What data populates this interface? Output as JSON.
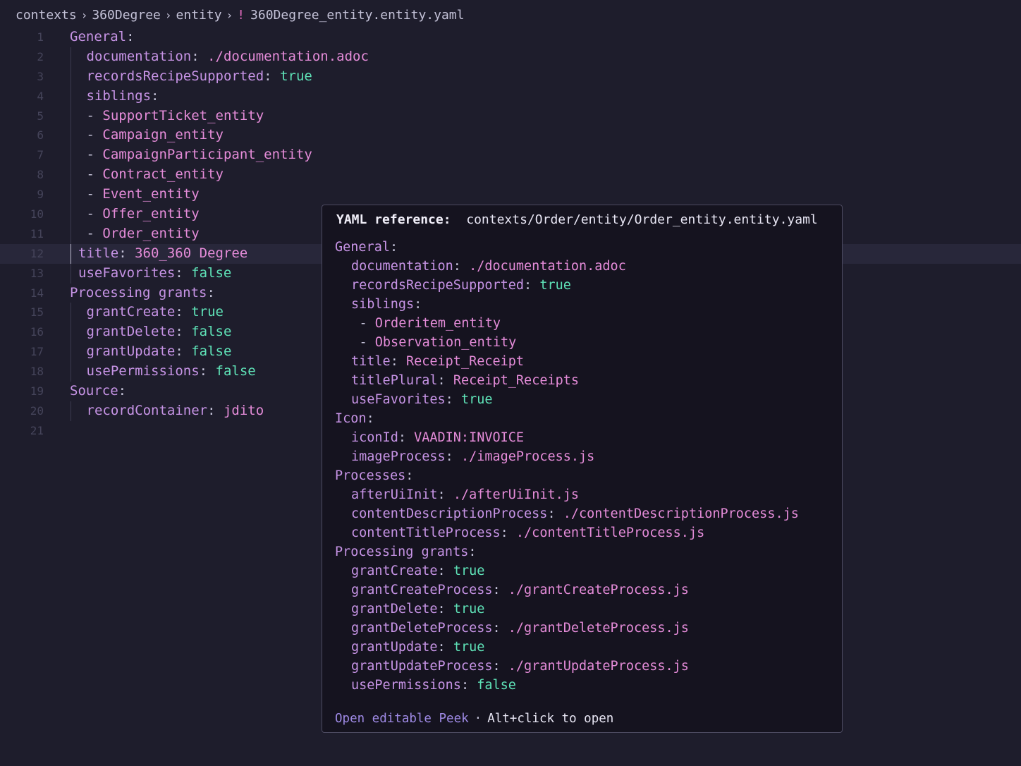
{
  "breadcrumb": {
    "items": [
      "contexts",
      "360Degree",
      "entity"
    ],
    "file_marker": "!",
    "file_name": "360Degree_entity.entity.yaml"
  },
  "editor": {
    "active_line": 12,
    "lines": [
      {
        "n": "1",
        "indent": 0,
        "guide": false,
        "parts": [
          {
            "t": "General",
            "c": "k"
          },
          {
            "t": ":",
            "c": "p"
          }
        ]
      },
      {
        "n": "2",
        "indent": 1,
        "guide": true,
        "parts": [
          {
            "t": "documentation",
            "c": "k"
          },
          {
            "t": ": ",
            "c": "p"
          },
          {
            "t": "./documentation.adoc",
            "c": "s"
          }
        ]
      },
      {
        "n": "3",
        "indent": 1,
        "guide": true,
        "parts": [
          {
            "t": "recordsRecipeSupported",
            "c": "k"
          },
          {
            "t": ": ",
            "c": "p"
          },
          {
            "t": "true",
            "c": "b"
          }
        ]
      },
      {
        "n": "4",
        "indent": 1,
        "guide": true,
        "parts": [
          {
            "t": "siblings",
            "c": "k"
          },
          {
            "t": ":",
            "c": "p"
          }
        ]
      },
      {
        "n": "5",
        "indent": 1,
        "guide": true,
        "parts": [
          {
            "t": "- ",
            "c": "p"
          },
          {
            "t": "SupportTicket_entity",
            "c": "s"
          }
        ]
      },
      {
        "n": "6",
        "indent": 1,
        "guide": true,
        "parts": [
          {
            "t": "- ",
            "c": "p"
          },
          {
            "t": "Campaign_entity",
            "c": "s"
          }
        ]
      },
      {
        "n": "7",
        "indent": 1,
        "guide": true,
        "parts": [
          {
            "t": "- ",
            "c": "p"
          },
          {
            "t": "CampaignParticipant_entity",
            "c": "s"
          }
        ]
      },
      {
        "n": "8",
        "indent": 1,
        "guide": true,
        "parts": [
          {
            "t": "- ",
            "c": "p"
          },
          {
            "t": "Contract_entity",
            "c": "s"
          }
        ]
      },
      {
        "n": "9",
        "indent": 1,
        "guide": true,
        "parts": [
          {
            "t": "- ",
            "c": "p"
          },
          {
            "t": "Event_entity",
            "c": "s"
          }
        ]
      },
      {
        "n": "10",
        "indent": 1,
        "guide": true,
        "parts": [
          {
            "t": "- ",
            "c": "p"
          },
          {
            "t": "Offer_entity",
            "c": "s"
          }
        ]
      },
      {
        "n": "11",
        "indent": 1,
        "guide": true,
        "parts": [
          {
            "t": "- ",
            "c": "p"
          },
          {
            "t": "Order_entity",
            "c": "s"
          }
        ]
      },
      {
        "n": "12",
        "indent": 2,
        "guide": true,
        "parts": [
          {
            "t": "title",
            "c": "k"
          },
          {
            "t": ": ",
            "c": "p"
          },
          {
            "t": "360_360 Degree",
            "c": "s"
          }
        ]
      },
      {
        "n": "13",
        "indent": 2,
        "guide": true,
        "parts": [
          {
            "t": "useFavorites",
            "c": "k"
          },
          {
            "t": ": ",
            "c": "p"
          },
          {
            "t": "false",
            "c": "b"
          }
        ]
      },
      {
        "n": "14",
        "indent": 0,
        "guide": false,
        "parts": [
          {
            "t": "Processing grants",
            "c": "k"
          },
          {
            "t": ":",
            "c": "p"
          }
        ]
      },
      {
        "n": "15",
        "indent": 1,
        "guide": true,
        "parts": [
          {
            "t": "grantCreate",
            "c": "k"
          },
          {
            "t": ": ",
            "c": "p"
          },
          {
            "t": "true",
            "c": "b"
          }
        ]
      },
      {
        "n": "16",
        "indent": 1,
        "guide": true,
        "parts": [
          {
            "t": "grantDelete",
            "c": "k"
          },
          {
            "t": ": ",
            "c": "p"
          },
          {
            "t": "false",
            "c": "b"
          }
        ]
      },
      {
        "n": "17",
        "indent": 1,
        "guide": true,
        "parts": [
          {
            "t": "grantUpdate",
            "c": "k"
          },
          {
            "t": ": ",
            "c": "p"
          },
          {
            "t": "false",
            "c": "b"
          }
        ]
      },
      {
        "n": "18",
        "indent": 1,
        "guide": true,
        "parts": [
          {
            "t": "usePermissions",
            "c": "k"
          },
          {
            "t": ": ",
            "c": "p"
          },
          {
            "t": "false",
            "c": "b"
          }
        ]
      },
      {
        "n": "19",
        "indent": 0,
        "guide": false,
        "parts": [
          {
            "t": "Source",
            "c": "k"
          },
          {
            "t": ":",
            "c": "p"
          }
        ]
      },
      {
        "n": "20",
        "indent": 1,
        "guide": true,
        "parts": [
          {
            "t": "recordContainer",
            "c": "k"
          },
          {
            "t": ": ",
            "c": "p"
          },
          {
            "t": "jdito",
            "c": "s"
          }
        ]
      },
      {
        "n": "21",
        "indent": 0,
        "guide": false,
        "parts": []
      }
    ]
  },
  "hover": {
    "label": "YAML reference:",
    "path": "contexts/Order/entity/Order_entity.entity.yaml",
    "lines": [
      {
        "indent": 0,
        "parts": [
          {
            "t": "General",
            "c": "k"
          },
          {
            "t": ":",
            "c": "p"
          }
        ]
      },
      {
        "indent": 1,
        "parts": [
          {
            "t": "documentation",
            "c": "k"
          },
          {
            "t": ": ",
            "c": "p"
          },
          {
            "t": "./documentation.adoc",
            "c": "s"
          }
        ]
      },
      {
        "indent": 1,
        "parts": [
          {
            "t": "recordsRecipeSupported",
            "c": "k"
          },
          {
            "t": ": ",
            "c": "p"
          },
          {
            "t": "true",
            "c": "b"
          }
        ]
      },
      {
        "indent": 1,
        "parts": [
          {
            "t": "siblings",
            "c": "k"
          },
          {
            "t": ":",
            "c": "p"
          }
        ]
      },
      {
        "indent": 1.5,
        "parts": [
          {
            "t": "- ",
            "c": "p"
          },
          {
            "t": "Orderitem_entity",
            "c": "s"
          }
        ]
      },
      {
        "indent": 1.5,
        "parts": [
          {
            "t": "- ",
            "c": "p"
          },
          {
            "t": "Observation_entity",
            "c": "s"
          }
        ]
      },
      {
        "indent": 1,
        "parts": [
          {
            "t": "title",
            "c": "k"
          },
          {
            "t": ": ",
            "c": "p"
          },
          {
            "t": "Receipt_Receipt",
            "c": "s"
          }
        ]
      },
      {
        "indent": 1,
        "parts": [
          {
            "t": "titlePlural",
            "c": "k"
          },
          {
            "t": ": ",
            "c": "p"
          },
          {
            "t": "Receipt_Receipts",
            "c": "s"
          }
        ]
      },
      {
        "indent": 1,
        "parts": [
          {
            "t": "useFavorites",
            "c": "k"
          },
          {
            "t": ": ",
            "c": "p"
          },
          {
            "t": "true",
            "c": "b"
          }
        ]
      },
      {
        "indent": 0,
        "parts": [
          {
            "t": "Icon",
            "c": "k"
          },
          {
            "t": ":",
            "c": "p"
          }
        ]
      },
      {
        "indent": 1,
        "parts": [
          {
            "t": "iconId",
            "c": "k"
          },
          {
            "t": ": ",
            "c": "p"
          },
          {
            "t": "VAADIN:INVOICE",
            "c": "s"
          }
        ]
      },
      {
        "indent": 1,
        "parts": [
          {
            "t": "imageProcess",
            "c": "k"
          },
          {
            "t": ": ",
            "c": "p"
          },
          {
            "t": "./imageProcess.js",
            "c": "s"
          }
        ]
      },
      {
        "indent": 0,
        "parts": [
          {
            "t": "Processes",
            "c": "k"
          },
          {
            "t": ":",
            "c": "p"
          }
        ]
      },
      {
        "indent": 1,
        "parts": [
          {
            "t": "afterUiInit",
            "c": "k"
          },
          {
            "t": ": ",
            "c": "p"
          },
          {
            "t": "./afterUiInit.js",
            "c": "s"
          }
        ]
      },
      {
        "indent": 1,
        "parts": [
          {
            "t": "contentDescriptionProcess",
            "c": "k"
          },
          {
            "t": ": ",
            "c": "p"
          },
          {
            "t": "./contentDescriptionProcess.js",
            "c": "s"
          }
        ]
      },
      {
        "indent": 1,
        "parts": [
          {
            "t": "contentTitleProcess",
            "c": "k"
          },
          {
            "t": ": ",
            "c": "p"
          },
          {
            "t": "./contentTitleProcess.js",
            "c": "s"
          }
        ]
      },
      {
        "indent": 0,
        "parts": [
          {
            "t": "Processing grants",
            "c": "k"
          },
          {
            "t": ":",
            "c": "p"
          }
        ]
      },
      {
        "indent": 1,
        "parts": [
          {
            "t": "grantCreate",
            "c": "k"
          },
          {
            "t": ": ",
            "c": "p"
          },
          {
            "t": "true",
            "c": "b"
          }
        ]
      },
      {
        "indent": 1,
        "parts": [
          {
            "t": "grantCreateProcess",
            "c": "k"
          },
          {
            "t": ": ",
            "c": "p"
          },
          {
            "t": "./grantCreateProcess.js",
            "c": "s"
          }
        ]
      },
      {
        "indent": 1,
        "parts": [
          {
            "t": "grantDelete",
            "c": "k"
          },
          {
            "t": ": ",
            "c": "p"
          },
          {
            "t": "true",
            "c": "b"
          }
        ]
      },
      {
        "indent": 1,
        "parts": [
          {
            "t": "grantDeleteProcess",
            "c": "k"
          },
          {
            "t": ": ",
            "c": "p"
          },
          {
            "t": "./grantDeleteProcess.js",
            "c": "s"
          }
        ]
      },
      {
        "indent": 1,
        "parts": [
          {
            "t": "grantUpdate",
            "c": "k"
          },
          {
            "t": ": ",
            "c": "p"
          },
          {
            "t": "true",
            "c": "b"
          }
        ]
      },
      {
        "indent": 1,
        "parts": [
          {
            "t": "grantUpdateProcess",
            "c": "k"
          },
          {
            "t": ": ",
            "c": "p"
          },
          {
            "t": "./grantUpdateProcess.js",
            "c": "s"
          }
        ]
      },
      {
        "indent": 1,
        "parts": [
          {
            "t": "usePermissions",
            "c": "k"
          },
          {
            "t": ": ",
            "c": "p"
          },
          {
            "t": "false",
            "c": "b"
          }
        ]
      }
    ],
    "footer": {
      "link": "Open editable Peek",
      "separator": "·",
      "hint": "Alt+click to open"
    }
  },
  "colors": {
    "background": "#1e1d2c",
    "key": "#c794e6",
    "string": "#e58cd9",
    "boolean": "#5fe3b8",
    "hover_background": "#15131f",
    "link": "#9f8ae6"
  }
}
